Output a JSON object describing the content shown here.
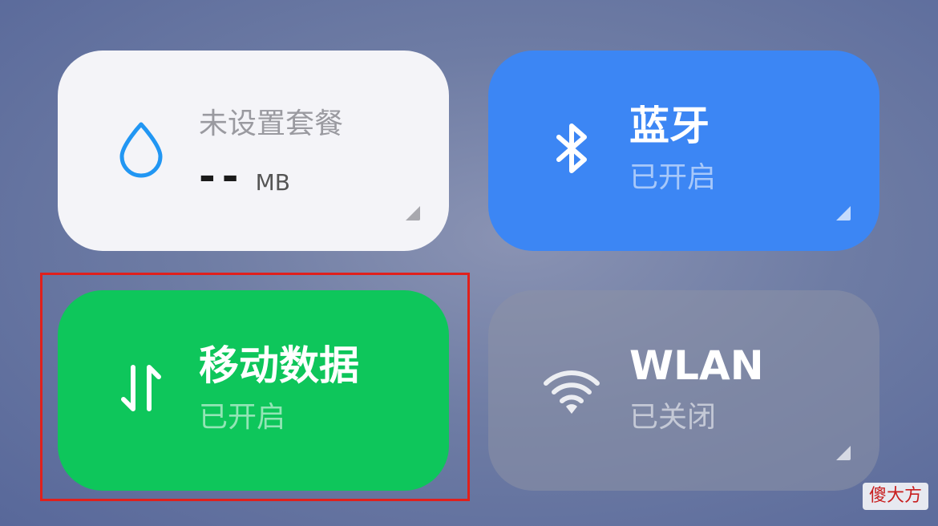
{
  "tiles": {
    "data": {
      "plan_label": "未设置套餐",
      "usage_value": "--",
      "usage_unit": "MB",
      "icon": "water-drop-icon",
      "background": "#f4f4f8",
      "accent": "#2196f3"
    },
    "bluetooth": {
      "title": "蓝牙",
      "status": "已开启",
      "icon": "bluetooth-icon",
      "background": "#3c86f4"
    },
    "mobile_data": {
      "title": "移动数据",
      "status": "已开启",
      "icon": "data-transfer-icon",
      "background": "#0ec65b"
    },
    "wlan": {
      "title": "WLAN",
      "status": "已关闭",
      "icon": "wifi-icon",
      "background": "#8c91a5"
    }
  },
  "highlight": {
    "color": "#e0201c"
  },
  "watermark": {
    "text": "傻大方"
  }
}
